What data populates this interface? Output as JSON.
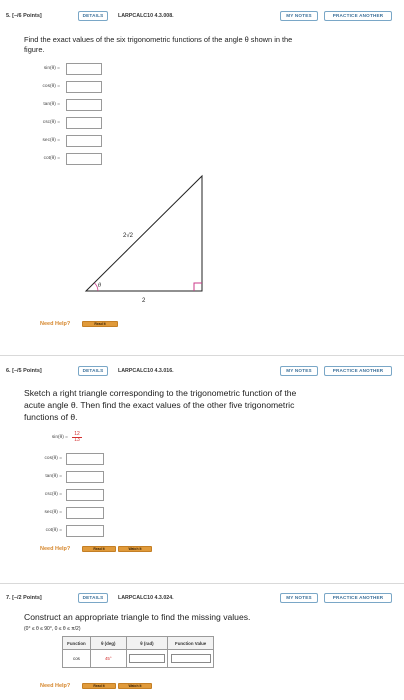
{
  "q5": {
    "number": "5.",
    "points": "[–/6 Points]",
    "details": "DETAILS",
    "id": "LARPCALC10 4.3.008.",
    "my_notes": "MY NOTES",
    "practice": "PRACTICE ANOTHER",
    "prompt_l1": "Find the exact values of the six trigonometric functions of the angle θ shown in the",
    "prompt_l2": "figure.",
    "functions": [
      "sin(θ) =",
      "cos(θ) =",
      "tan(θ) =",
      "csc(θ) =",
      "sec(θ) =",
      "cot(θ) ="
    ],
    "figure": {
      "hypotenuse_label": "2√2",
      "base_label": "2",
      "angle_label": "θ"
    },
    "need_help": "Need Help?",
    "read_it": "Read It"
  },
  "q6": {
    "number": "6.",
    "points": "[–/5 Points]",
    "details": "DETAILS",
    "id": "LARPCALC10 4.3.016.",
    "my_notes": "MY NOTES",
    "practice": "PRACTICE ANOTHER",
    "prompt_l1": "Sketch a right triangle corresponding to the trigonometric function of the",
    "prompt_l2": "acute angle θ. Then find the exact values of the other five trigonometric",
    "prompt_l3": "functions of θ.",
    "given_label": "sin(θ) =",
    "given_num": "12",
    "given_den": "13",
    "functions": [
      "cos(θ) =",
      "tan(θ) =",
      "csc(θ) =",
      "sec(θ) =",
      "cot(θ) ="
    ],
    "need_help": "Need Help?",
    "read_it": "Read It",
    "watch_it": "Watch It"
  },
  "q7": {
    "number": "7.",
    "points": "[–/2 Points]",
    "details": "DETAILS",
    "id": "LARPCALC10 4.3.024.",
    "my_notes": "MY NOTES",
    "practice": "PRACTICE ANOTHER",
    "prompt": "Construct an appropriate triangle to find the missing values.",
    "constraint": "(0° ≤ θ ≤ 90°, 0 ≤ θ ≤ π/2)",
    "table_headers": [
      "Function",
      "θ (deg)",
      "θ (rad)",
      "Function Value"
    ],
    "row": {
      "function": "cos",
      "deg": "45°"
    },
    "need_help": "Need Help?",
    "read_it": "Read It",
    "watch_it": "Watch It"
  },
  "colors": {
    "accent_blue": "#3a6f99",
    "help_orange": "#d6872d",
    "button_orange": "#e09a3a",
    "answer_red": "#d32f2f",
    "triangle_line": "#222222",
    "right_angle_mark": "#cc3a8a"
  }
}
